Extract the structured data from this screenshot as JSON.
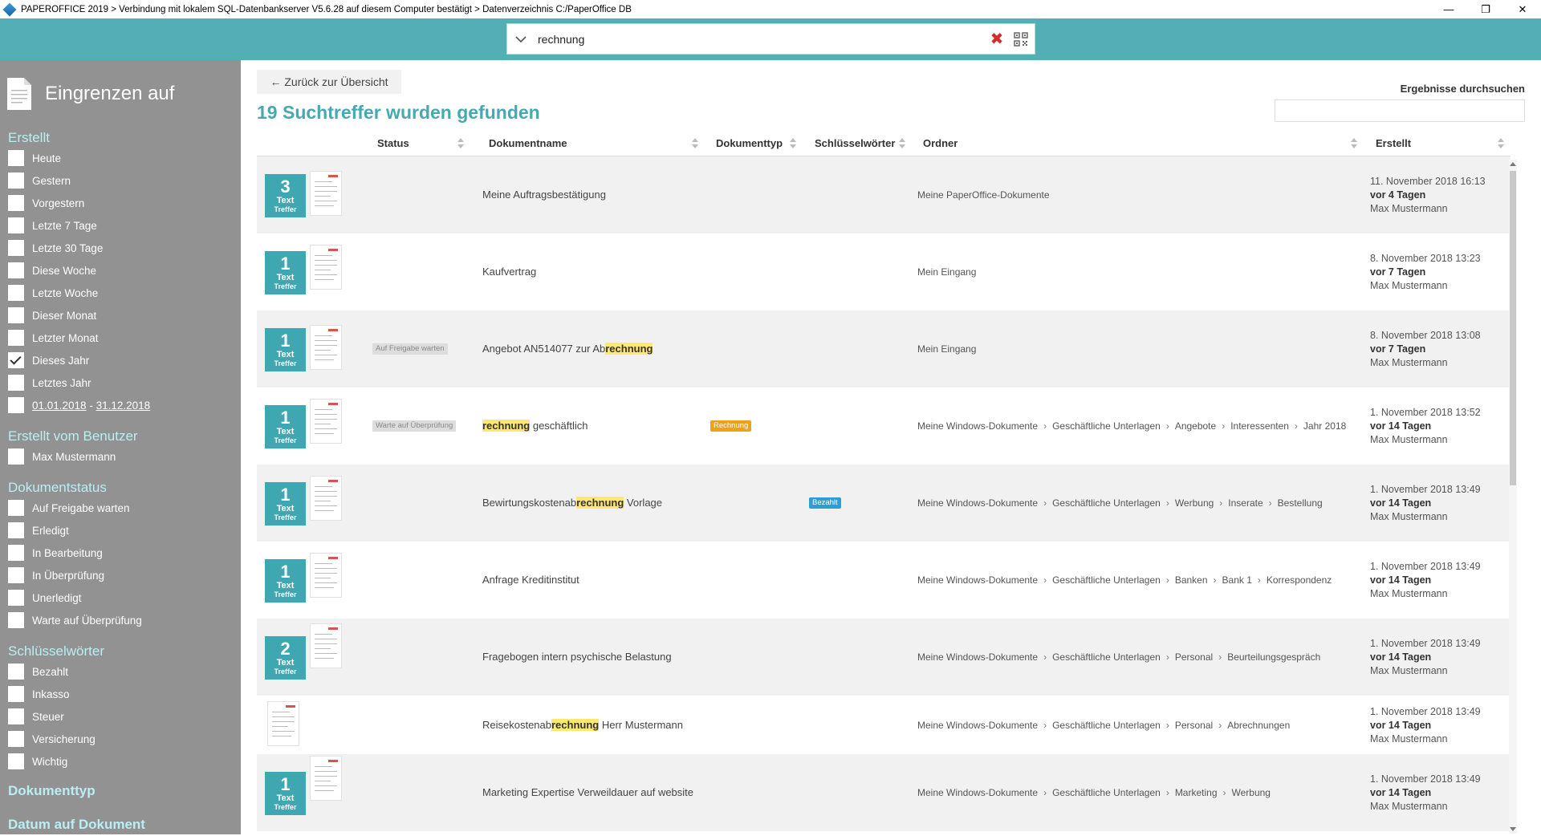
{
  "window": {
    "title": "PAPEROFFICE 2019 > Verbindung mit lokalem SQL-Datenbankserver V5.6.28 auf diesem Computer bestätigt > Datenverzeichnis C:/PaperOffice DB",
    "minimize": "—",
    "maximize": "❐",
    "close": "✕"
  },
  "search": {
    "value": "rechnung",
    "clear": "✖"
  },
  "sidebar": {
    "title": "Eingrenzen auf",
    "sections": [
      {
        "label": "Erstellt",
        "items": [
          {
            "label": "Heute",
            "checked": false
          },
          {
            "label": "Gestern",
            "checked": false
          },
          {
            "label": "Vorgestern",
            "checked": false
          },
          {
            "label": "Letzte 7 Tage",
            "checked": false
          },
          {
            "label": "Letzte 30 Tage",
            "checked": false
          },
          {
            "label": "Diese Woche",
            "checked": false
          },
          {
            "label": "Letzte Woche",
            "checked": false
          },
          {
            "label": "Dieser Monat",
            "checked": false
          },
          {
            "label": "Letzter Monat",
            "checked": false
          },
          {
            "label": "Dieses Jahr",
            "checked": true
          },
          {
            "label": "Letztes Jahr",
            "checked": false
          }
        ],
        "range": {
          "from": "01.01.2018",
          "sep": " - ",
          "to": "31.12.2018"
        }
      },
      {
        "label": "Erstellt vom Benutzer",
        "items": [
          {
            "label": "Max Mustermann",
            "checked": false
          }
        ]
      },
      {
        "label": "Dokumentstatus",
        "items": [
          {
            "label": "Auf Freigabe warten",
            "checked": false
          },
          {
            "label": "Erledigt",
            "checked": false
          },
          {
            "label": "In Bearbeitung",
            "checked": false
          },
          {
            "label": "In Überprüfung",
            "checked": false
          },
          {
            "label": "Unerledigt",
            "checked": false
          },
          {
            "label": "Warte auf Überprüfung",
            "checked": false
          }
        ]
      },
      {
        "label": "Schlüsselwörter",
        "items": [
          {
            "label": "Bezahlt",
            "checked": false
          },
          {
            "label": "Inkasso",
            "checked": false
          },
          {
            "label": "Steuer",
            "checked": false
          },
          {
            "label": "Versicherung",
            "checked": false
          },
          {
            "label": "Wichtig",
            "checked": false
          }
        ]
      }
    ],
    "bottom_sections": [
      "Dokumenttyp",
      "Datum auf Dokument"
    ]
  },
  "main": {
    "back_label": "← Zurück zur Übersicht",
    "results_title": "19 Suchtreffer wurden gefunden",
    "search_results_label": "Ergebnisse durchsuchen",
    "columns": {
      "status": "Status",
      "name": "Dokumentname",
      "type": "Dokumenttyp",
      "keywords": "Schlüsselwörter",
      "folder": "Ordner",
      "created": "Erstellt"
    },
    "hit_label_1": "Text",
    "hit_label_2": "Treffer",
    "rows": [
      {
        "hits": "3",
        "status": "",
        "name": [
          {
            "t": "Meine Auftragsbestätigung",
            "hl": false
          }
        ],
        "type": "",
        "keyword": "",
        "folder": [
          "Meine PaperOffice-Dokumente"
        ],
        "date": "11. November 2018 16:13",
        "ago": "vor 4 Tagen",
        "user": "Max Mustermann"
      },
      {
        "hits": "1",
        "status": "",
        "name": [
          {
            "t": "Kaufvertrag",
            "hl": false
          }
        ],
        "type": "",
        "keyword": "",
        "folder": [
          "Mein Eingang"
        ],
        "date": "8. November 2018 13:23",
        "ago": "vor 7 Tagen",
        "user": "Max Mustermann"
      },
      {
        "hits": "1",
        "status": "Auf Freigabe warten",
        "name": [
          {
            "t": "Angebot AN514077 zur Ab",
            "hl": false
          },
          {
            "t": "rechnung",
            "hl": true
          }
        ],
        "type": "",
        "keyword": "",
        "folder": [
          "Mein Eingang"
        ],
        "date": "8. November 2018 13:08",
        "ago": "vor 7 Tagen",
        "user": "Max Mustermann"
      },
      {
        "hits": "1",
        "status": "Warte auf Überprüfung",
        "name": [
          {
            "t": "rechnung",
            "hl": true
          },
          {
            "t": " geschäftlich",
            "hl": false
          }
        ],
        "type": "Rechnung",
        "keyword": "",
        "folder": [
          "Meine Windows-Dokumente",
          "Geschäftliche Unterlagen",
          "Angebote",
          "Interessenten",
          "Jahr 2018"
        ],
        "date": "1. November 2018 13:52",
        "ago": "vor 14 Tagen",
        "user": "Max Mustermann"
      },
      {
        "hits": "1",
        "status": "",
        "name": [
          {
            "t": "Bewirtungskostenab",
            "hl": false
          },
          {
            "t": "rechnung",
            "hl": true
          },
          {
            "t": " Vorlage",
            "hl": false
          }
        ],
        "type": "",
        "keyword": "Bezahlt",
        "folder": [
          "Meine Windows-Dokumente",
          "Geschäftliche Unterlagen",
          "Werbung",
          "Inserate",
          "Bestellung"
        ],
        "date": "1. November 2018 13:49",
        "ago": "vor 14 Tagen",
        "user": "Max Mustermann"
      },
      {
        "hits": "1",
        "status": "",
        "name": [
          {
            "t": "Anfrage Kreditinstitut",
            "hl": false
          }
        ],
        "type": "",
        "keyword": "",
        "folder": [
          "Meine Windows-Dokumente",
          "Geschäftliche Unterlagen",
          "Banken",
          "Bank 1",
          "Korrespondenz"
        ],
        "date": "1. November 2018 13:49",
        "ago": "vor 14 Tagen",
        "user": "Max Mustermann"
      },
      {
        "hits": "2",
        "status": "",
        "name": [
          {
            "t": "Fragebogen intern psychische Belastung",
            "hl": false
          }
        ],
        "type": "",
        "keyword": "",
        "folder": [
          "Meine Windows-Dokumente",
          "Geschäftliche Unterlagen",
          "Personal",
          "Beurteilungsgespräch"
        ],
        "date": "1. November 2018 13:49",
        "ago": "vor 14 Tagen",
        "user": "Max Mustermann"
      },
      {
        "hits": "",
        "status": "",
        "name": [
          {
            "t": "Reisekostenab",
            "hl": false
          },
          {
            "t": "rechnung",
            "hl": true
          },
          {
            "t": " Herr Mustermann",
            "hl": false
          }
        ],
        "type": "",
        "keyword": "",
        "folder": [
          "Meine Windows-Dokumente",
          "Geschäftliche Unterlagen",
          "Personal",
          "Abrechnungen"
        ],
        "date": "1. November 2018 13:49",
        "ago": "vor 14 Tagen",
        "user": "Max Mustermann"
      },
      {
        "hits": "1",
        "status": "",
        "name": [
          {
            "t": "Marketing Expertise Verweildauer auf website",
            "hl": false
          }
        ],
        "type": "",
        "keyword": "",
        "folder": [
          "Meine Windows-Dokumente",
          "Geschäftliche Unterlagen",
          "Marketing",
          "Werbung"
        ],
        "date": "1. November 2018 13:49",
        "ago": "vor 14 Tagen",
        "user": "Max Mustermann"
      }
    ]
  },
  "colors": {
    "teal": "#53aeb6",
    "hit": "#3fa7b1",
    "highlight": "#ffe872",
    "type_badge": "#f0a11a",
    "keyword_badge": "#2a9fd6"
  }
}
